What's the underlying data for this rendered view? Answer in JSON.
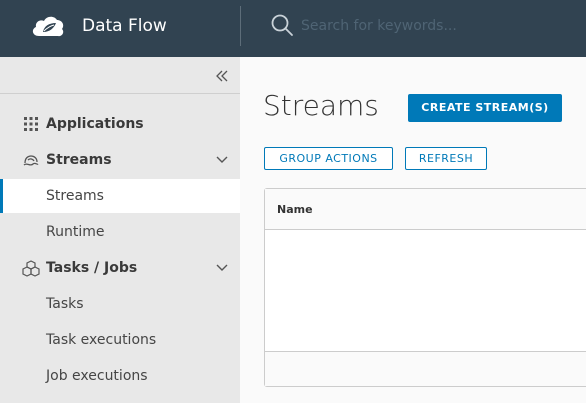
{
  "header": {
    "app_title": "Data Flow",
    "logo_icon": "spring-leaf-cloud-icon",
    "search": {
      "placeholder": "Search for keywords...",
      "value": "",
      "icon": "search-icon"
    },
    "background": "#314351"
  },
  "sidebar": {
    "collapse_icon": "double-chevron-left-icon",
    "items": [
      {
        "label": "Applications",
        "type": "section",
        "icon": "grid-icon"
      },
      {
        "label": "Streams",
        "type": "section",
        "icon": "streams-icon",
        "expanded": true
      },
      {
        "label": "Streams",
        "type": "link",
        "active": true
      },
      {
        "label": "Runtime",
        "type": "link"
      },
      {
        "label": "Tasks / Jobs",
        "type": "section",
        "icon": "tasks-icon",
        "expanded": true
      },
      {
        "label": "Tasks",
        "type": "link"
      },
      {
        "label": "Task executions",
        "type": "link"
      },
      {
        "label": "Job executions",
        "type": "link"
      }
    ]
  },
  "main": {
    "title": "Streams",
    "create_button": "CREATE STREAM(S)",
    "group_actions_button": "GROUP ACTIONS",
    "refresh_button": "REFRESH",
    "table": {
      "columns": [
        "Name"
      ],
      "rows": []
    }
  },
  "colors": {
    "accent": "#0079b8",
    "header": "#314351",
    "sidebar": "#e8e8e8"
  }
}
